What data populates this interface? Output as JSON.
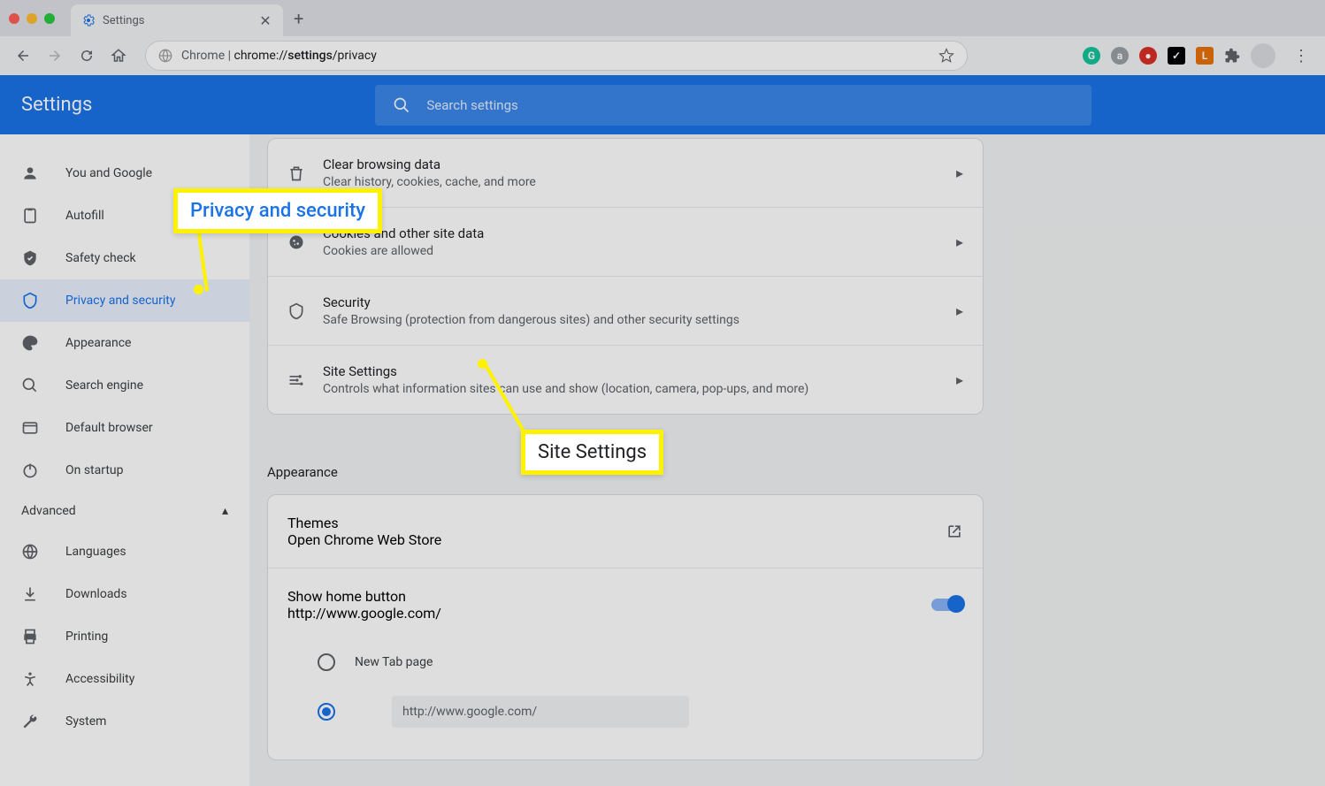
{
  "browser": {
    "tab_title": "Settings",
    "url_label": "Chrome",
    "url_path": "chrome://settings/privacy",
    "search_placeholder": "Search settings"
  },
  "header": {
    "title": "Settings"
  },
  "sidebar": {
    "items": [
      {
        "label": "You and Google",
        "icon": "person"
      },
      {
        "label": "Autofill",
        "icon": "autofill"
      },
      {
        "label": "Safety check",
        "icon": "shield-check"
      },
      {
        "label": "Privacy and security",
        "icon": "shield",
        "active": true
      },
      {
        "label": "Appearance",
        "icon": "palette"
      },
      {
        "label": "Search engine",
        "icon": "search"
      },
      {
        "label": "Default browser",
        "icon": "browser"
      },
      {
        "label": "On startup",
        "icon": "power"
      }
    ],
    "advanced_label": "Advanced",
    "advanced_items": [
      {
        "label": "Languages",
        "icon": "globe"
      },
      {
        "label": "Downloads",
        "icon": "download"
      },
      {
        "label": "Printing",
        "icon": "print"
      },
      {
        "label": "Accessibility",
        "icon": "accessibility"
      },
      {
        "label": "System",
        "icon": "wrench"
      }
    ]
  },
  "privacy_items": [
    {
      "title": "Clear browsing data",
      "sub": "Clear history, cookies, cache, and more",
      "icon": "trash"
    },
    {
      "title": "Cookies and other site data",
      "sub": "Cookies are allowed",
      "icon": "cookie"
    },
    {
      "title": "Security",
      "sub": "Safe Browsing (protection from dangerous sites) and other security settings",
      "icon": "security"
    },
    {
      "title": "Site Settings",
      "sub": "Controls what information sites can use and show (location, camera, pop-ups, and more)",
      "icon": "tune"
    }
  ],
  "appearance": {
    "section_title": "Appearance",
    "themes_title": "Themes",
    "themes_sub": "Open Chrome Web Store",
    "home_button_title": "Show home button",
    "home_button_sub": "http://www.google.com/",
    "home_button_on": true,
    "radio_newtab": "New Tab page",
    "radio_custom_value": "http://www.google.com/"
  },
  "callouts": {
    "privacy": "Privacy and security",
    "site_settings": "Site Settings"
  }
}
